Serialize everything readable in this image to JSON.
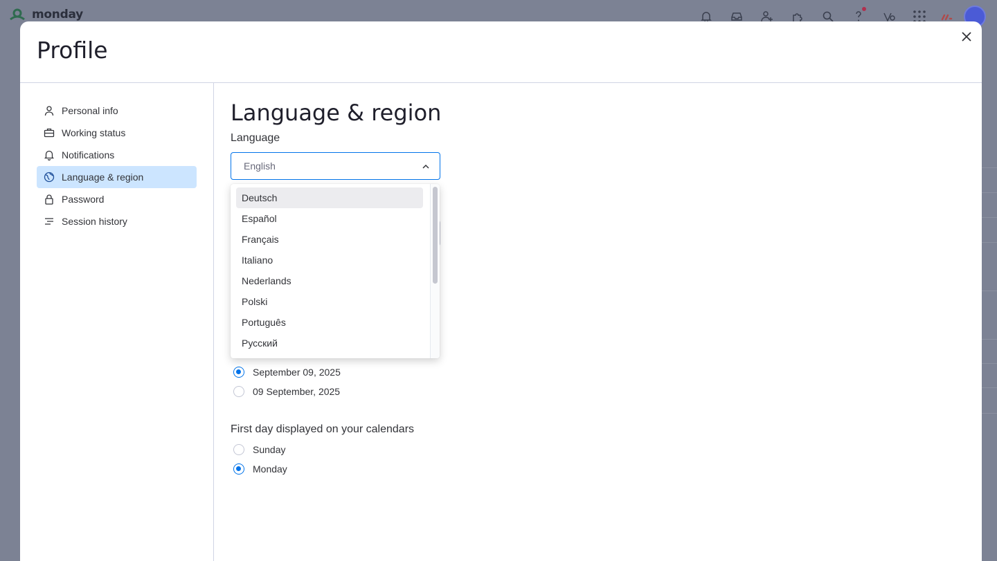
{
  "topbar": {
    "brand": "monday",
    "icons": [
      "bell-icon",
      "inbox-icon",
      "invite-icon",
      "apps-icon",
      "search-icon",
      "help-icon",
      "ai-icon",
      "grid-icon",
      "monday-logo-icon",
      "avatar"
    ]
  },
  "modal": {
    "title": "Profile",
    "close_icon": "close-icon"
  },
  "sidebar": {
    "items": [
      {
        "label": "Personal info",
        "icon": "person-icon"
      },
      {
        "label": "Working status",
        "icon": "briefcase-icon"
      },
      {
        "label": "Notifications",
        "icon": "bell-icon"
      },
      {
        "label": "Language & region",
        "icon": "globe-icon",
        "active": true
      },
      {
        "label": "Password",
        "icon": "lock-icon"
      },
      {
        "label": "Session history",
        "icon": "list-icon"
      }
    ]
  },
  "content": {
    "heading": "Language & region",
    "language_label": "Language",
    "language_value": "English",
    "language_options": [
      "Deutsch",
      "Español",
      "Français",
      "Italiano",
      "Nederlands",
      "Polski",
      "Português",
      "Русский"
    ],
    "date_options": [
      {
        "label": "September 09, 2025",
        "selected": true
      },
      {
        "label": "09 September, 2025",
        "selected": false
      }
    ],
    "first_day_label": "First day displayed on your calendars",
    "first_day_options": [
      {
        "label": "Sunday",
        "selected": false
      },
      {
        "label": "Monday",
        "selected": true
      }
    ]
  },
  "colors": {
    "accent": "#0073ea",
    "active_nav_bg": "#cce5ff",
    "overlay": "#7c8294"
  }
}
